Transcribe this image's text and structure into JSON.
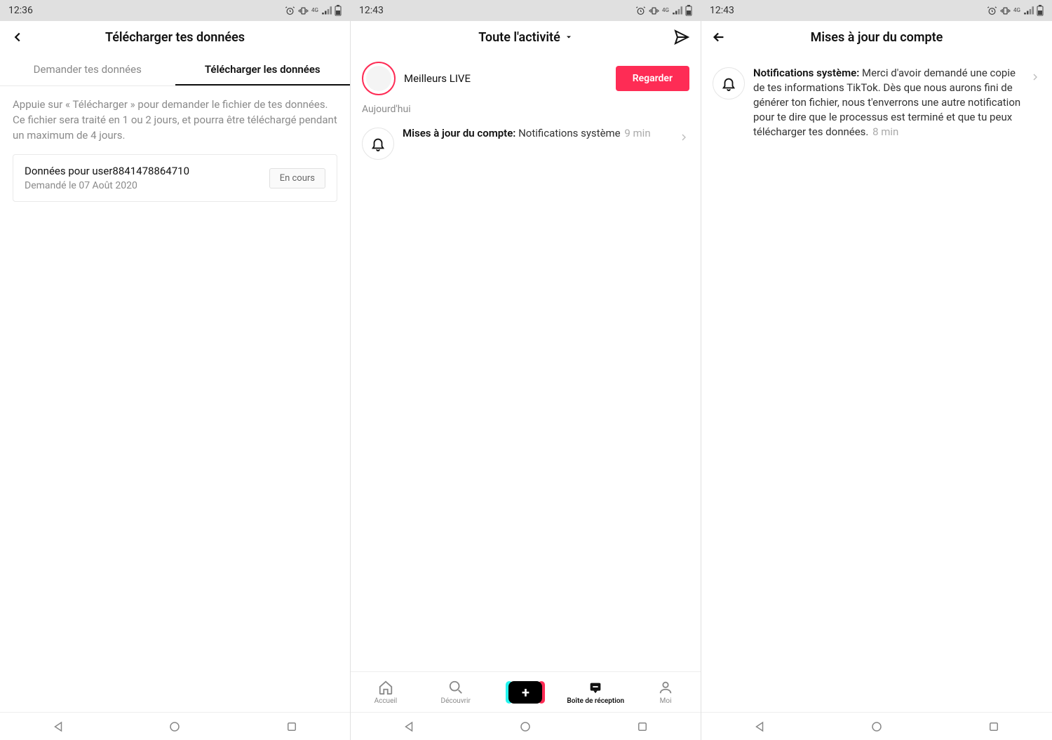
{
  "screens": {
    "left": {
      "time": "12:36",
      "title": "Télécharger tes données",
      "tabs": [
        "Demander tes données",
        "Télécharger les données"
      ],
      "helper": "Appuie sur « Télécharger » pour demander le fichier de tes données. Ce fichier sera traité en 1 ou 2 jours, et pourra être téléchargé pendant un maximum de 4 jours.",
      "card": {
        "title": "Données pour user8841478864710",
        "subtitle": "Demandé le 07 Août 2020",
        "status": "En cours"
      }
    },
    "middle": {
      "time": "12:43",
      "title": "Toute l'activité",
      "live_label": "Meilleurs LIVE",
      "watch_label": "Regarder",
      "section": "Aujourd'hui",
      "notification": {
        "bold": "Mises à jour du compte:",
        "rest": " Notifications système",
        "time": " 9 min"
      },
      "tabbar": {
        "home": "Accueil",
        "discover": "Découvrir",
        "inbox": "Boîte de réception",
        "me": "Moi"
      }
    },
    "right": {
      "time": "12:43",
      "title": "Mises à jour du compte",
      "notification": {
        "bold": "Notifications système:",
        "rest": " Merci d'avoir demandé une copie de tes informations TikTok. Dès que nous aurons fini de générer ton fichier, nous t'enverrons une autre notification pour te dire que le processus est terminé et que tu peux télécharger tes données.",
        "time": " 8 min"
      }
    }
  }
}
